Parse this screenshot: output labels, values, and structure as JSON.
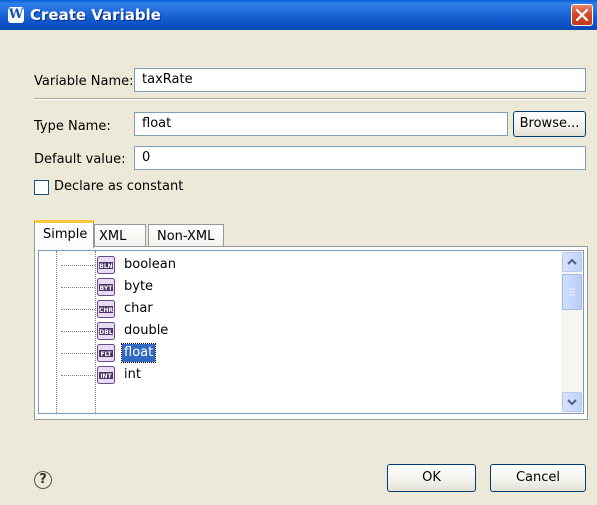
{
  "window": {
    "title": "Create Variable",
    "icon": "w-app-icon"
  },
  "form": {
    "variable_name_label": "Variable Name:",
    "variable_name_value": "taxRate",
    "type_name_label": "Type Name:",
    "type_name_value": "float",
    "browse_label": "Browse...",
    "default_value_label": "Default value:",
    "default_value_value": "0",
    "declare_constant_label": "Declare as constant",
    "declare_constant_checked": false
  },
  "tabs": [
    {
      "label": "Simple",
      "active": true
    },
    {
      "label": "XML",
      "active": false
    },
    {
      "label": "Non-XML",
      "active": false
    }
  ],
  "tree": {
    "items": [
      {
        "label": "boolean",
        "icon": "BLN",
        "selected": false
      },
      {
        "label": "byte",
        "icon": "BYT",
        "selected": false
      },
      {
        "label": "char",
        "icon": "CHR",
        "selected": false
      },
      {
        "label": "double",
        "icon": "DBL",
        "selected": false
      },
      {
        "label": "float",
        "icon": "FLT",
        "selected": true
      },
      {
        "label": "int",
        "icon": "INT",
        "selected": false
      }
    ]
  },
  "footer": {
    "help_symbol": "?",
    "ok_label": "OK",
    "cancel_label": "Cancel"
  },
  "colors": {
    "titlebar": "#0b4fc4",
    "dialog_bg": "#ece9d8",
    "selection": "#316ac5"
  }
}
